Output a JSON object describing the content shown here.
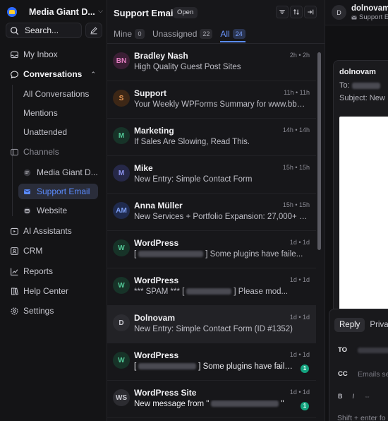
{
  "workspace": {
    "name": "Media Giant D..."
  },
  "search": {
    "label": "Search..."
  },
  "nav": {
    "my_inbox": "My Inbox",
    "conversations": "Conversations",
    "sub": [
      "All Conversations",
      "Mentions",
      "Unattended"
    ],
    "channels": "Channels",
    "channel_items": [
      "Media Giant D...",
      "Support Email",
      "Website"
    ],
    "ai_assistants": "AI Assistants",
    "crm": "CRM",
    "reports": "Reports",
    "help_center": "Help Center",
    "settings": "Settings"
  },
  "list": {
    "title": "Support Email",
    "status": "Open",
    "tabs": [
      {
        "label": "Mine",
        "count": "0"
      },
      {
        "label": "Unassigned",
        "count": "22"
      },
      {
        "label": "All",
        "count": "24"
      }
    ],
    "rows": [
      {
        "initials": "BN",
        "name": "Bradley Nash",
        "time": "2h • 2h",
        "preview": "High Quality Guest Post Sites"
      },
      {
        "initials": "S",
        "name": "Support",
        "time": "11h • 11h",
        "preview": "Your Weekly WPForms Summary for www.bbb..."
      },
      {
        "initials": "M",
        "name": "Marketing",
        "time": "14h • 14h",
        "preview": "If Sales Are Slowing, Read This."
      },
      {
        "initials": "M",
        "name": "Mike",
        "time": "15h • 15h",
        "preview": "New Entry: Simple Contact Form"
      },
      {
        "initials": "AM",
        "name": "Anna Müller",
        "time": "15h • 15h",
        "preview": "New Services + Portfolio Expansion: 27,000+ L..."
      },
      {
        "initials": "W",
        "name": "WordPress",
        "time": "1d • 1d",
        "preview_a": "[",
        "preview_b": "] Some plugins have faile..."
      },
      {
        "initials": "W",
        "name": "WordPress",
        "time": "1d • 1d",
        "preview_a": "*** SPAM *** [",
        "preview_b": "] Please mod..."
      },
      {
        "initials": "D",
        "name": "Dolnovam",
        "time": "1d • 1d",
        "preview": "New Entry: Simple Contact Form (ID #1352)"
      },
      {
        "initials": "W",
        "name": "WordPress",
        "time": "1d • 1d",
        "preview_a": "[",
        "preview_b": "] Some plugins have faile...",
        "unread": "1"
      },
      {
        "initials": "WS",
        "name": "WordPress Site",
        "time": "1d • 1d",
        "preview_a": "New message from \"",
        "preview_b": "\"",
        "unread": "1"
      }
    ]
  },
  "detail": {
    "initial": "D",
    "name": "dolnovam",
    "channel": "Support E",
    "from": "dolnovam",
    "to_label": "To:",
    "subject_label": "Subject: New",
    "reply_tabs": [
      "Reply",
      "Privat"
    ],
    "to": "TO",
    "cc": "CC",
    "cc_placeholder": "Emails se",
    "fmt": [
      "B",
      "I",
      "⇔"
    ],
    "hint": "Shift + enter fo"
  },
  "colors": {
    "accent": "#5b8cff",
    "unread": "#14a37f"
  }
}
